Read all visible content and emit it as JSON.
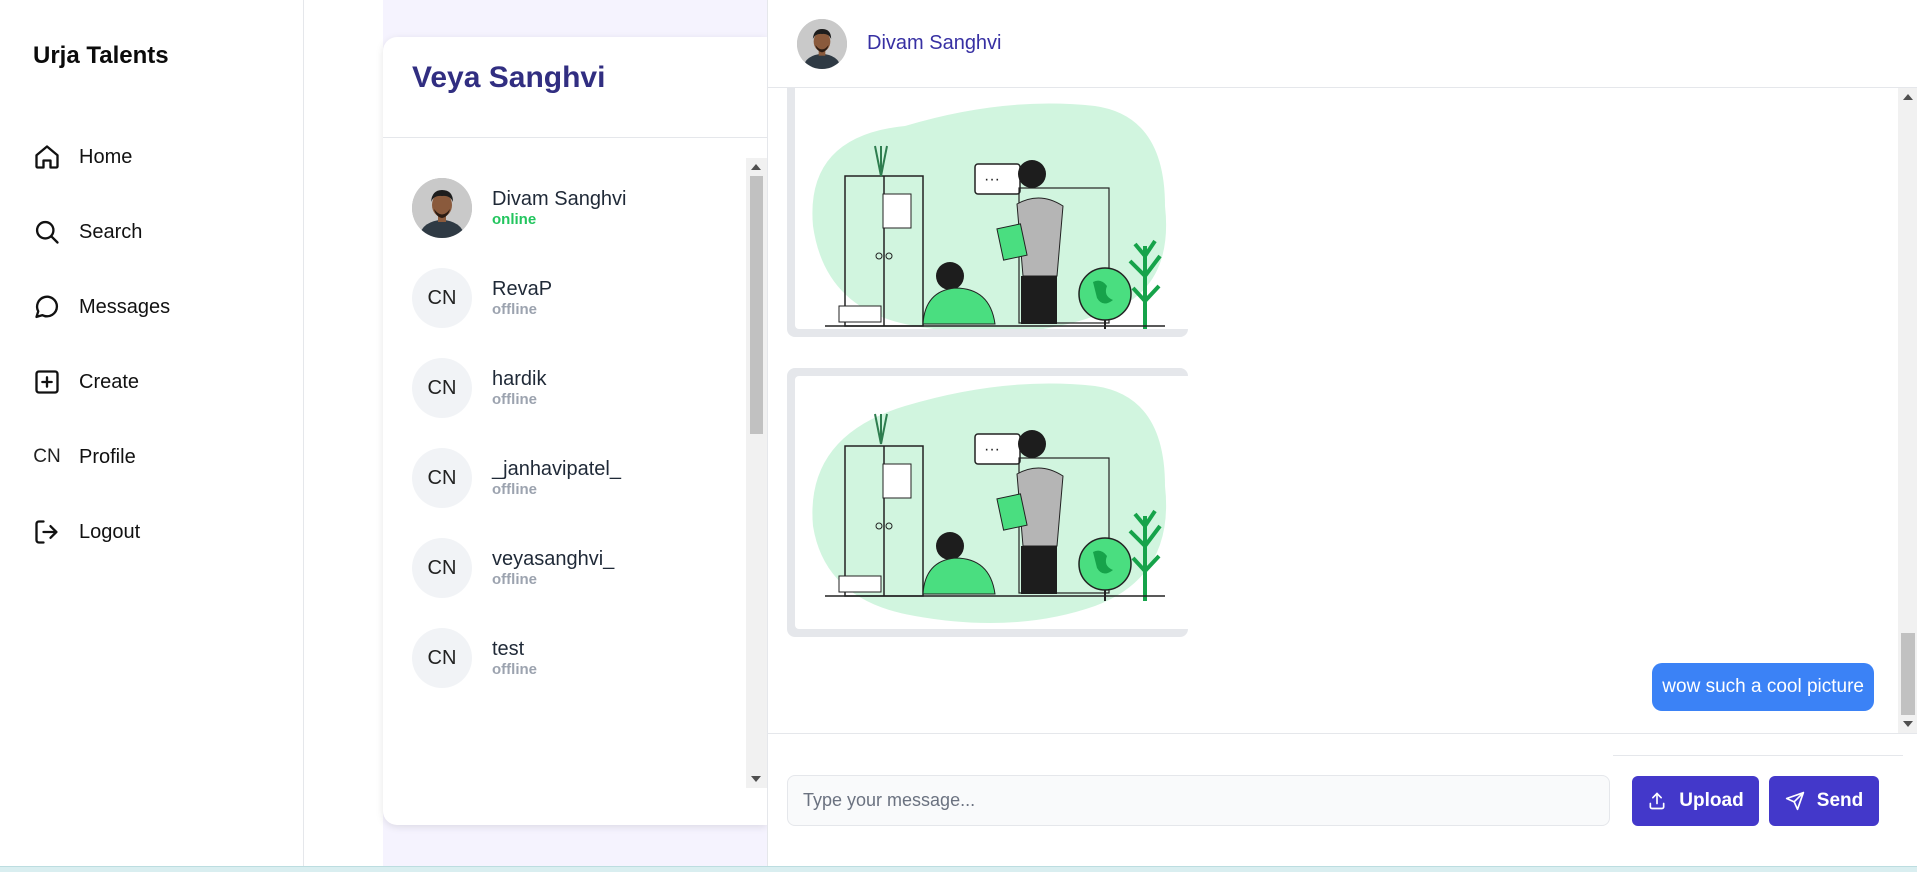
{
  "sidebar": {
    "brand": "Urja Talents",
    "items": [
      {
        "label": "Home",
        "icon": "home-icon"
      },
      {
        "label": "Search",
        "icon": "search-icon"
      },
      {
        "label": "Messages",
        "icon": "message-circle-icon"
      },
      {
        "label": "Create",
        "icon": "plus-square-icon"
      },
      {
        "label": "Profile",
        "icon": "CN"
      },
      {
        "label": "Logout",
        "icon": "logout-icon"
      }
    ]
  },
  "contacts": {
    "title": "Veya Sanghvi",
    "list": [
      {
        "name": "Divam Sanghvi",
        "status": "online",
        "avatar": "photo"
      },
      {
        "name": "RevaP",
        "status": "offline",
        "avatar": "CN"
      },
      {
        "name": "hardik",
        "status": "offline",
        "avatar": "CN"
      },
      {
        "name": "_janhavipatel_",
        "status": "offline",
        "avatar": "CN"
      },
      {
        "name": "veyasanghvi_",
        "status": "offline",
        "avatar": "CN"
      },
      {
        "name": "test",
        "status": "offline",
        "avatar": "CN"
      }
    ]
  },
  "chat": {
    "header_name": "Divam Sanghvi",
    "messages": [
      {
        "type": "image",
        "content": "teacher-student-illustration"
      },
      {
        "type": "image",
        "content": "teacher-student-illustration"
      },
      {
        "type": "text",
        "text": "wow such a cool picture",
        "color": "#3b82f6"
      }
    ],
    "input_placeholder": "Type your message...",
    "upload_label": "Upload",
    "send_label": "Send"
  },
  "colors": {
    "accent": "#4338ca",
    "title": "#312e81",
    "online": "#22c55e",
    "bubble": "#3b82f6",
    "illustration_green": "#d1f5df"
  }
}
